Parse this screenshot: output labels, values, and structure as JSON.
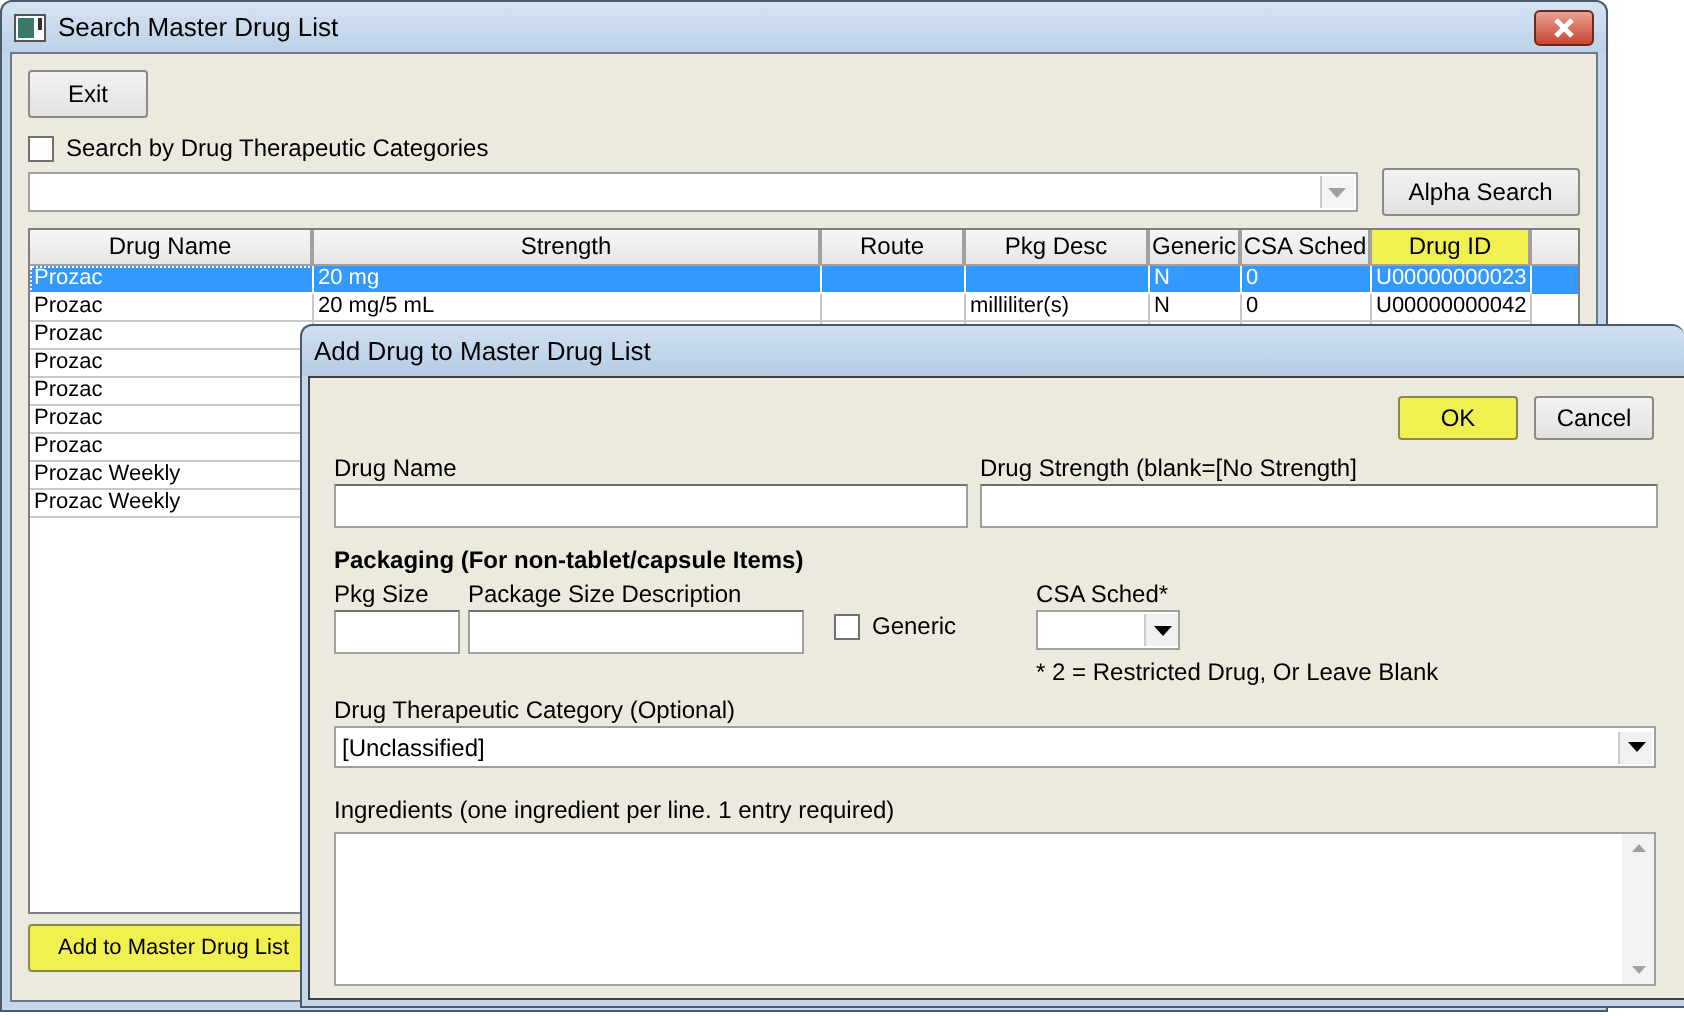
{
  "main_window": {
    "title": "Search Master Drug List",
    "exit_button": "Exit",
    "category_search": {
      "label": "Search by Drug Therapeutic Categories",
      "checked": false
    },
    "alpha_search_button": {
      "label": "Alpha Search"
    },
    "table": {
      "columns": [
        {
          "label": "Drug Name",
          "highlighted": false
        },
        {
          "label": "Strength",
          "highlighted": false
        },
        {
          "label": "Route",
          "highlighted": false
        },
        {
          "label": "Pkg Desc",
          "highlighted": false
        },
        {
          "label": "Generic",
          "highlighted": false
        },
        {
          "label": "CSA Sched",
          "highlighted": false
        },
        {
          "label": "Drug ID",
          "highlighted": true
        }
      ],
      "rows": [
        {
          "selected": true,
          "cells": [
            "Prozac",
            "20 mg",
            "",
            "",
            "N",
            "0",
            "U00000000023"
          ]
        },
        {
          "selected": false,
          "cells": [
            "Prozac",
            "20 mg/5 mL",
            "",
            "milliliter(s)",
            "N",
            "0",
            "U00000000042"
          ]
        },
        {
          "selected": false,
          "cells": [
            "Prozac"
          ]
        },
        {
          "selected": false,
          "cells": [
            "Prozac"
          ]
        },
        {
          "selected": false,
          "cells": [
            "Prozac"
          ]
        },
        {
          "selected": false,
          "cells": [
            "Prozac"
          ]
        },
        {
          "selected": false,
          "cells": [
            "Prozac"
          ]
        },
        {
          "selected": false,
          "cells": [
            "Prozac Weekly"
          ]
        },
        {
          "selected": false,
          "cells": [
            "Prozac Weekly"
          ]
        }
      ]
    },
    "add_button": {
      "label": "Add to Master Drug List"
    }
  },
  "dialog": {
    "title": "Add Drug to Master Drug List",
    "ok_button": "OK",
    "cancel_button": "Cancel",
    "drug_name_label": "Drug Name",
    "drug_strength_label": "Drug Strength (blank=[No Strength]",
    "packaging_heading": "Packaging (For non-tablet/capsule Items)",
    "pkg_size_label": "Pkg Size",
    "package_desc_label": "Package Size Description",
    "generic": {
      "label": "Generic",
      "checked": false
    },
    "csa_label": "CSA Sched*",
    "csa_note": "* 2 = Restricted Drug, Or Leave Blank",
    "category_label": "Drug Therapeutic Category (Optional)",
    "category_value": "[Unclassified]",
    "ingredients_label": "Ingredients (one ingredient per line. 1 entry required)"
  }
}
